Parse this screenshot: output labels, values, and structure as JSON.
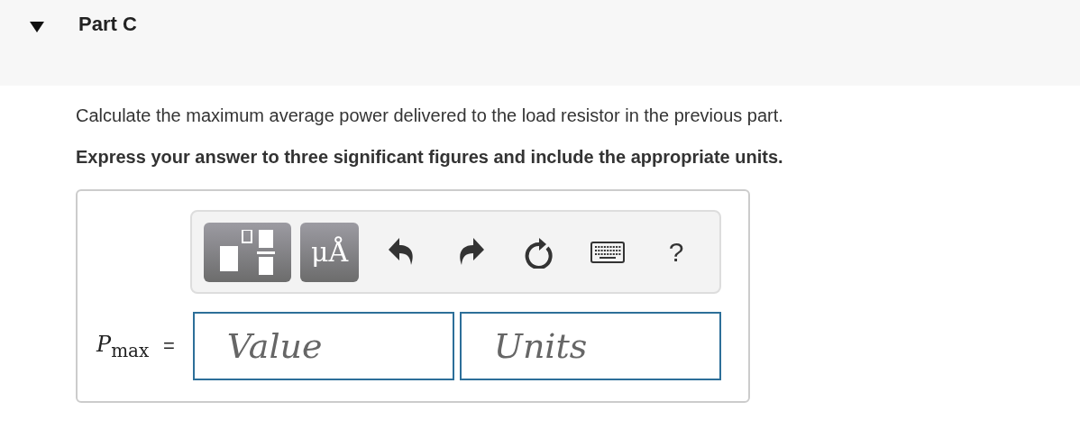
{
  "part": {
    "title": "Part C",
    "expanded": true
  },
  "question": "Calculate the maximum average power delivered to the load resistor in the previous part.",
  "instruction": "Express your answer to three significant figures and include the appropriate units.",
  "toolbar": [
    {
      "kind": "templates"
    },
    {
      "kind": "units",
      "label": "μÅ"
    },
    {
      "kind": "undo"
    },
    {
      "kind": "redo"
    },
    {
      "kind": "reset"
    },
    {
      "kind": "keyboard"
    },
    {
      "kind": "help",
      "label": "?"
    }
  ],
  "answer": {
    "variable": "*P*$_{max}$",
    "equals": "=",
    "value": {
      "placeholder": "Value"
    },
    "units": {
      "placeholder": "Units"
    }
  }
}
